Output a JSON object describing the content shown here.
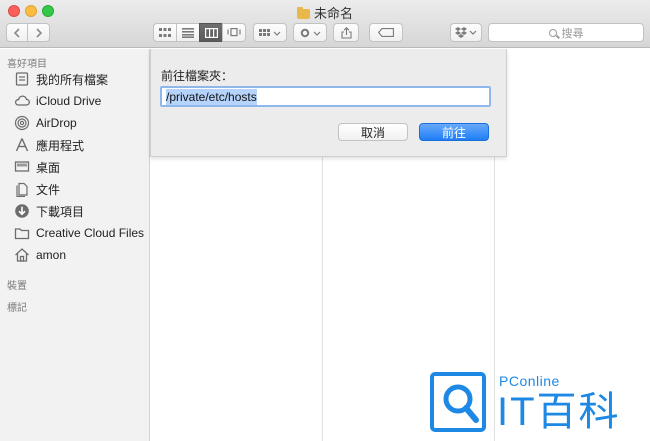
{
  "window": {
    "title": "未命名"
  },
  "toolbar": {
    "back_icon": "chevron-left-icon",
    "forward_icon": "chevron-right-icon",
    "view_modes": [
      "icon-view",
      "list-view",
      "column-view",
      "cover-flow-view"
    ],
    "selected_view": "column-view",
    "search_placeholder": "搜尋"
  },
  "sidebar": {
    "favorites_heading": "喜好項目",
    "items": [
      {
        "label": "我的所有檔案",
        "icon": "all-files-icon"
      },
      {
        "label": "iCloud Drive",
        "icon": "cloud-icon"
      },
      {
        "label": "AirDrop",
        "icon": "airdrop-icon"
      },
      {
        "label": "應用程式",
        "icon": "applications-icon"
      },
      {
        "label": "桌面",
        "icon": "desktop-icon"
      },
      {
        "label": "文件",
        "icon": "documents-icon"
      },
      {
        "label": "下載項目",
        "icon": "downloads-icon"
      },
      {
        "label": "Creative Cloud Files",
        "icon": "folder-icon"
      },
      {
        "label": "amon",
        "icon": "home-icon"
      }
    ],
    "devices_heading": "裝置",
    "tags_heading": "標記"
  },
  "goto_sheet": {
    "label": "前往檔案夾：",
    "path_value": "/private/etc/hosts",
    "cancel_label": "取消",
    "go_label": "前往"
  },
  "watermark": {
    "small_text": "PConline",
    "big_text": "IT百科"
  },
  "colors": {
    "accent": "#1f7ef6",
    "selection": "#b5d3fb",
    "watermark": "#1e88e5"
  }
}
